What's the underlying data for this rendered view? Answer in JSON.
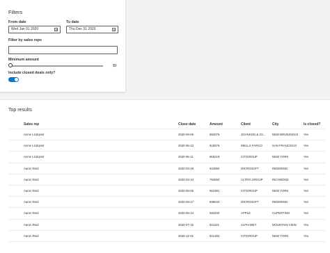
{
  "filters": {
    "title": "Filters",
    "from_date_label": "From date",
    "from_date_value": "Wed Jan 01 2020",
    "to_date_label": "To date",
    "to_date_value": "Thu Dec 31 2020",
    "sales_rep_label": "Filter by sales reps",
    "sales_rep_value": "",
    "min_amount_label": "Minimum amount",
    "min_amount_value": "$0",
    "min_amount_level": 0,
    "closed_label": "Include closed deals only?",
    "closed_on": true,
    "accent_color": "#0078d4"
  },
  "results": {
    "title": "Top results",
    "columns": [
      "Sales rep",
      "Close date",
      "Amount",
      "Client",
      "City",
      "Is closed?"
    ],
    "rows": [
      [
        "Annie Lindqvist",
        "2020-09-06",
        "892075",
        "JOHNSON & JO...",
        "NEW BRUNSWICK",
        "Yes"
      ],
      [
        "Annie Lindqvist",
        "2020-05-22",
        "818976",
        "WELLS FARGO",
        "SAN FRANCISCO",
        "Yes"
      ],
      [
        "Annie Lindqvist",
        "2020-06-11",
        "865218",
        "CITIGROUP",
        "NEW YORK",
        "Yes"
      ],
      [
        "Aaron Reid",
        "2020-03-28",
        "624850",
        "MICROSOFT",
        "REDMOND",
        "Yes"
      ],
      [
        "Aaron Reid",
        "2020-04-10",
        "794094",
        "ALTRIA GROUP",
        "RICHMOND",
        "Yes"
      ],
      [
        "Aaron Reid",
        "2020-06-05",
        "862381",
        "CITIGROUP",
        "NEW YORK",
        "Yes"
      ],
      [
        "Aaron Reid",
        "2020-09-17",
        "898033",
        "MICROSOFT",
        "REDMOND",
        "Yes"
      ],
      [
        "Aaron Reid",
        "2020-06-24",
        "584200",
        "APPLE",
        "CUPERTINO",
        "Yes"
      ],
      [
        "Aaron Reid",
        "2020-07-15",
        "821101",
        "ALPHABET",
        "MOUNTAIN VIEW",
        "Yes"
      ],
      [
        "Aaron Reid",
        "2020-12-01",
        "821384",
        "CITIGROUP",
        "NEW YORK",
        "Yes"
      ]
    ]
  }
}
